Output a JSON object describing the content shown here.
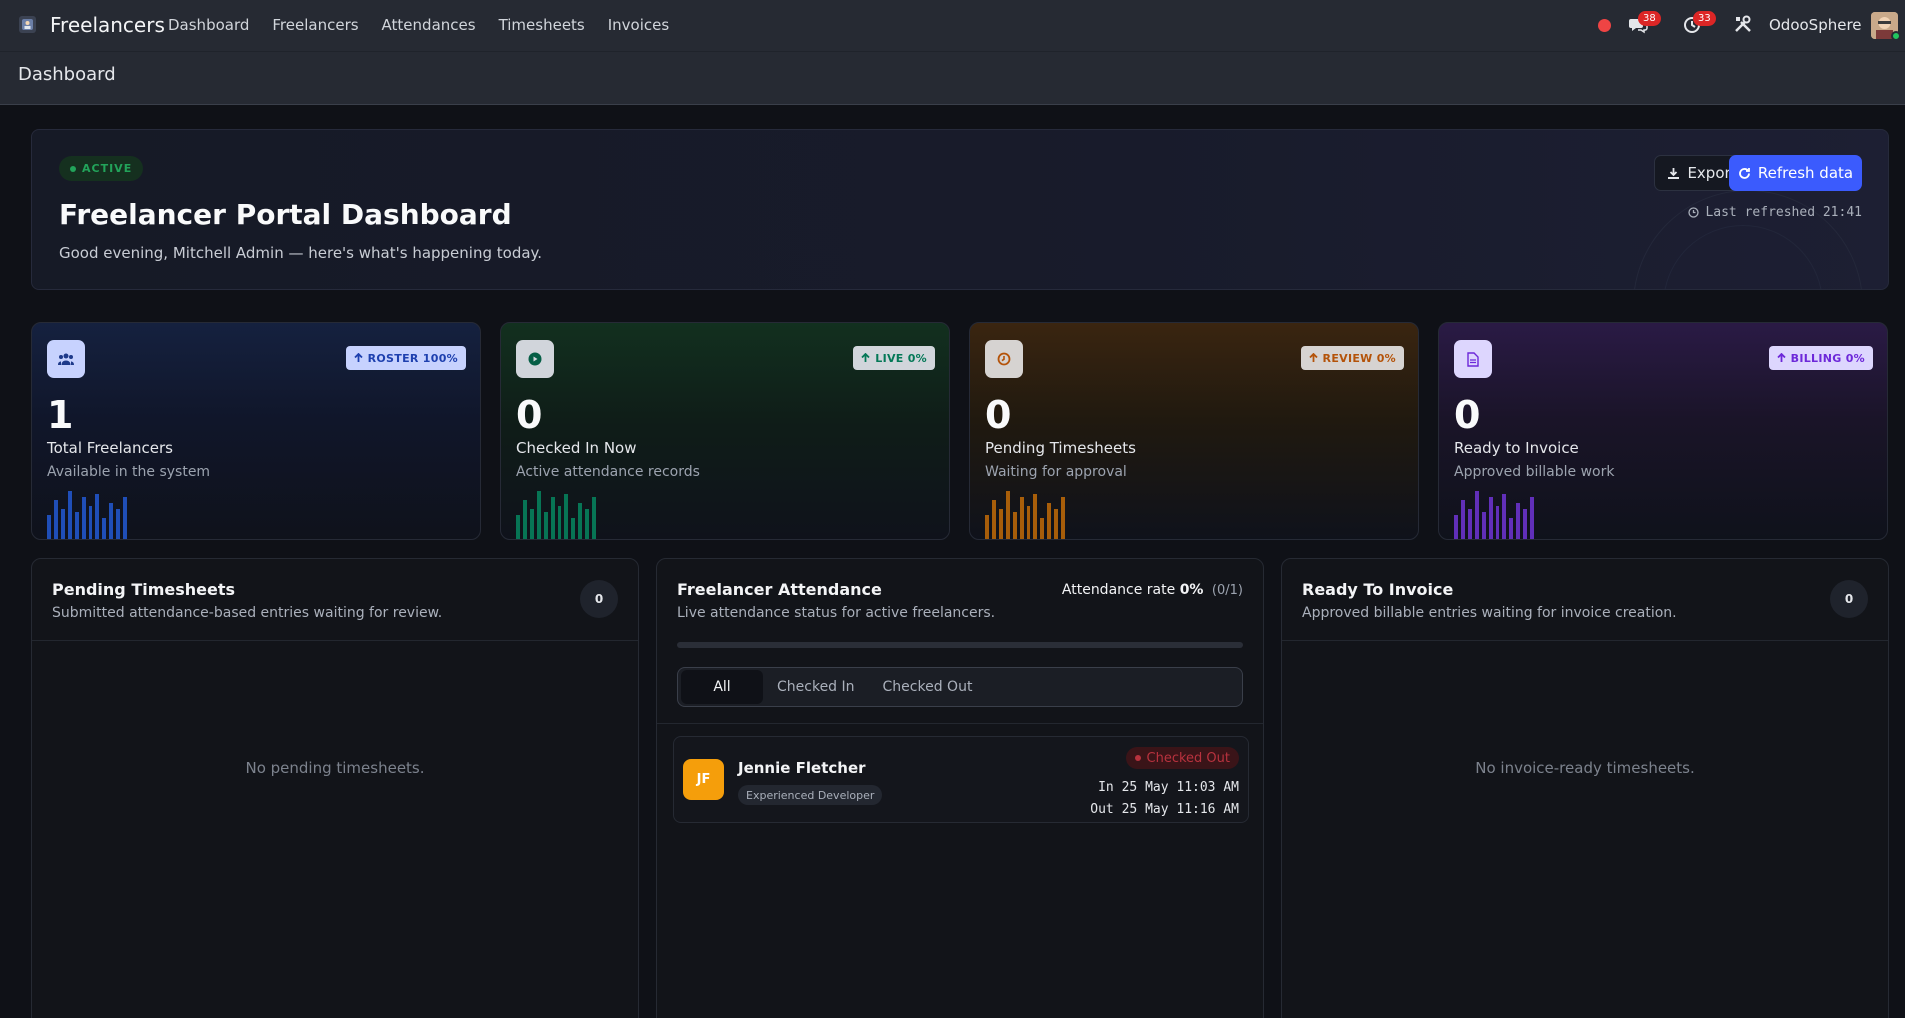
{
  "app": {
    "name": "Freelancers"
  },
  "menu": [
    "Dashboard",
    "Freelancers",
    "Attendances",
    "Timesheets",
    "Invoices"
  ],
  "tray": {
    "messages_count": "38",
    "activities_count": "33",
    "company": "OdooSphere"
  },
  "breadcrumb": "Dashboard",
  "hero": {
    "status": "ACTIVE",
    "title": "Freelancer Portal Dashboard",
    "subtitle": "Good evening, Mitchell Admin — here's what's happening today.",
    "export_label": "Export",
    "refresh_label": "Refresh data",
    "last_refreshed": "Last refreshed 21:41"
  },
  "kpis": [
    {
      "badge": "ROSTER 100%",
      "value": "1",
      "label": "Total Freelancers",
      "sub": "Available in the system",
      "color": "#3b82f6"
    },
    {
      "badge": "LIVE 0%",
      "value": "0",
      "label": "Checked In Now",
      "sub": "Active attendance records",
      "color": "#10b981"
    },
    {
      "badge": "REVIEW 0%",
      "value": "0",
      "label": "Pending Timesheets",
      "sub": "Waiting for approval",
      "color": "#f59e0b"
    },
    {
      "badge": "BILLING 0%",
      "value": "0",
      "label": "Ready to Invoice",
      "sub": "Approved billable work",
      "color": "#8b5cf6"
    }
  ],
  "pending": {
    "title": "Pending Timesheets",
    "subtitle": "Submitted attendance-based entries waiting for review.",
    "count": "0",
    "empty": "No pending timesheets."
  },
  "attendance": {
    "title": "Freelancer Attendance",
    "subtitle": "Live attendance status for active freelancers.",
    "rate_label": "Attendance rate",
    "rate_value": "0%",
    "rate_fraction": "(0/1)",
    "rate_progress": 0,
    "filters": [
      "All",
      "Checked In",
      "Checked Out"
    ],
    "active_filter": "All",
    "records": [
      {
        "initials": "JF",
        "name": "Jennie Fletcher",
        "role": "Experienced Developer",
        "status": "Checked Out",
        "check_in": "In 25 May 11:03 AM",
        "check_out": "Out 25 May 11:16 AM"
      }
    ]
  },
  "invoice": {
    "title": "Ready To Invoice",
    "subtitle": "Approved billable entries waiting for invoice creation.",
    "count": "0",
    "empty": "No invoice-ready timesheets."
  }
}
